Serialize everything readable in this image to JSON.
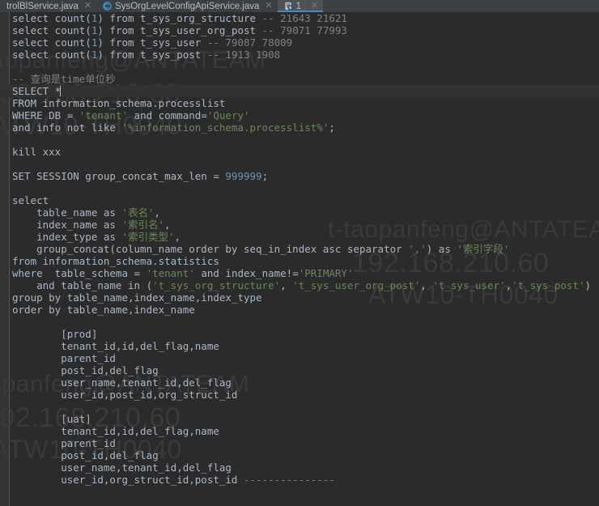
{
  "tabs": [
    {
      "label": "trolBlService.java",
      "icon": "",
      "active": false,
      "closable": true
    },
    {
      "label": "SysOrgLevelConfigApiService.java",
      "icon": "class-icon",
      "active": false,
      "closable": true
    },
    {
      "label": "1",
      "icon": "console-query-icon",
      "active": true,
      "closable": true
    }
  ],
  "editor": {
    "language": "sql",
    "caret_line": 5,
    "lines": [
      "select count(1) from t_sys_org_structure -- 21643 21621",
      "select count(1) from t_sys_user_org_post -- 79071 77993",
      "select count(1) from t_sys_user -- 79087 78009",
      "select count(1) from t_sys_post -- 1913 1908",
      "",
      "-- 查询是time单位秒",
      "SELECT *",
      "FROM information_schema.processlist",
      "WHERE DB = 'tenant' and command='Query'",
      "and info not like '%information_schema.processlist%';",
      "",
      "kill xxx",
      "",
      "SET SESSION group_concat_max_len = 999999;",
      "",
      "select",
      "    table_name as '表名',",
      "    index_name as '索引名',",
      "    index_type as '索引类型',",
      "    group_concat(column_name order by seq_in_index asc separator ',') as '索引字段'",
      "from information_schema.statistics",
      "where  table_schema = 'tenant' and index_name!='PRIMARY'",
      "    and table_name in ('t_sys_org_structure', 't_sys_user_org_post', 't_sys_user','t_sys_post')",
      "group by table_name,index_name,index_type",
      "order by table_name,index_name",
      "",
      "        [prod]",
      "        tenant_id,id,del_flag,name",
      "        parent_id",
      "        post_id,del_flag",
      "        user_name,tenant_id,del_flag",
      "        user_id,post_id,org_struct_id",
      "",
      "        [uat]",
      "        tenant_id,id,del_flag,name",
      "        parent_id",
      "        post_id,del_flag",
      "        user_name,tenant_id,del_flag",
      "        user_id,org_struct_id,post_id ---------------"
    ]
  },
  "watermark": {
    "user": "t-taopanfeng@ANTATEAM",
    "ip": "192.168.210.60",
    "host": "ATW10-TH0040"
  },
  "colors": {
    "background": "#2b2b2b",
    "gutter": "#313335",
    "tabbar": "#3c3f41",
    "tab_active": "#4e5254",
    "tab_underline": "#4a88c7",
    "text": "#a9b7c6",
    "comment": "#808080",
    "string": "#6a8759",
    "number": "#6897bb",
    "keyword": "#cc7832",
    "current_line": "#323232",
    "watermark": "#3a3a3a"
  }
}
